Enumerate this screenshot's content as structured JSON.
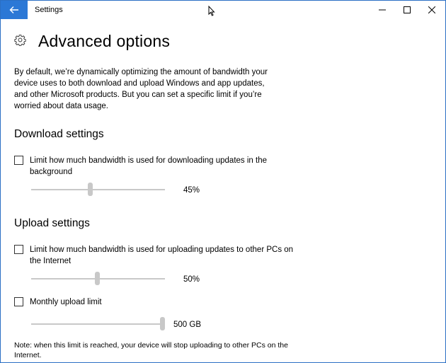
{
  "titlebar": {
    "app_title": "Settings",
    "back_icon": "back-arrow-icon",
    "minimize_icon": "minimize-icon",
    "maximize_icon": "maximize-icon",
    "close_icon": "close-icon"
  },
  "header": {
    "icon": "gear-icon",
    "title": "Advanced options"
  },
  "intro_text": "By default, we’re dynamically optimizing the amount of bandwidth your device uses to both download and upload Windows and app updates, and other Microsoft products. But you can set a specific limit if you’re worried about data usage.",
  "download": {
    "heading": "Download settings",
    "limit_label": "Limit how much bandwidth is used for downloading updates in the background",
    "limit_checked": false,
    "slider_value_text": "45%",
    "slider_fraction": 0.45
  },
  "upload": {
    "heading": "Upload settings",
    "limit_label": "Limit how much bandwidth is used for uploading updates to other PCs on the Internet",
    "limit_checked": false,
    "slider_value_text": "50%",
    "slider_fraction": 0.5,
    "monthly_label": "Monthly upload limit",
    "monthly_checked": false,
    "monthly_value_text": "500 GB",
    "monthly_fraction": 1.0
  },
  "note": "Note: when this limit is reached, your device will stop uploading to other PCs on the Internet.",
  "colors": {
    "accent": "#2b78d6",
    "slider_disabled": "#c8c8c8"
  }
}
